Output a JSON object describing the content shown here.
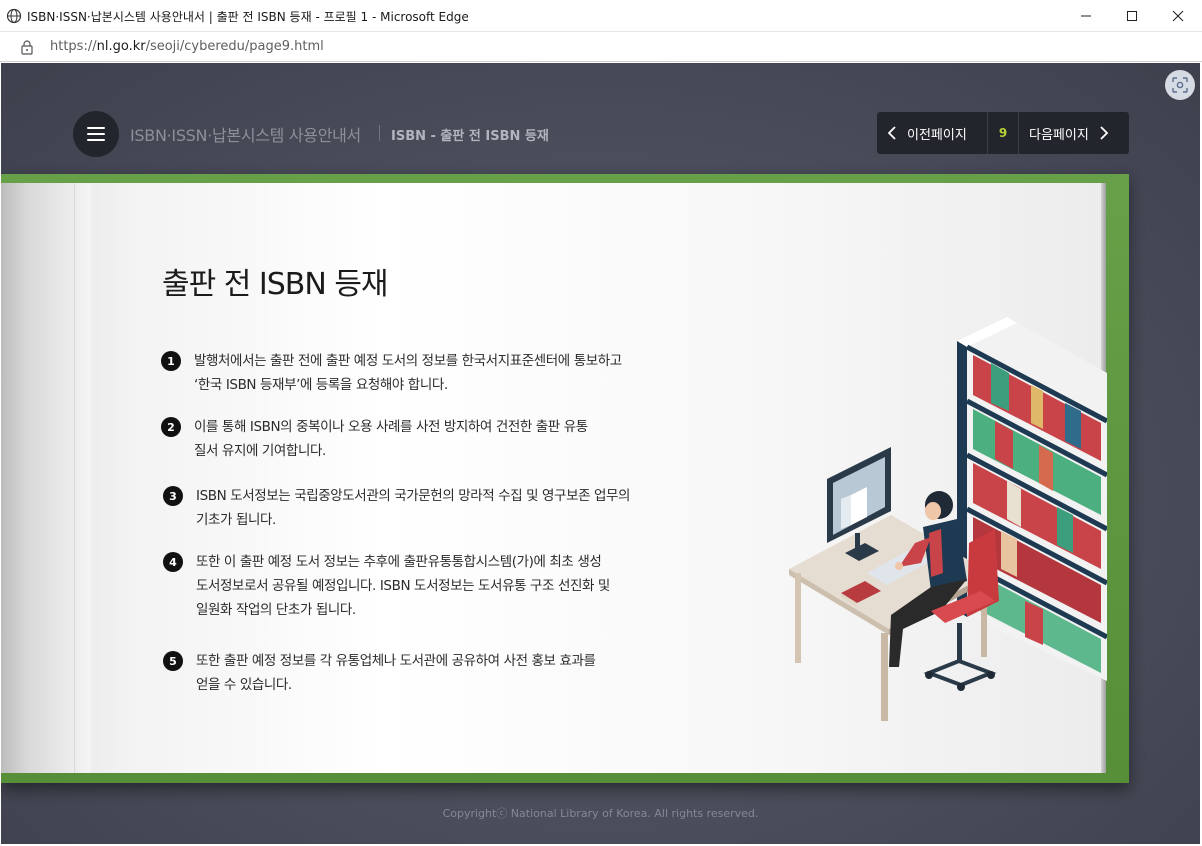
{
  "browser": {
    "title": "ISBN·ISSN·납본시스템 사용안내서 | 출판 전 ISBN 등재 - 프로필 1 - Microsoft Edge",
    "url_prefix": "https://",
    "url_host": "nl.go.kr",
    "url_path": "/seoji/cyberedu/page9.html"
  },
  "header": {
    "site_title": "ISBN·ISSN·납본시스템 사용안내서",
    "page_subtitle": "ISBN - 출판 전 ISBN 등재"
  },
  "pager": {
    "prev_label": "이전페이지",
    "page_number": "9",
    "next_label": "다음페이지",
    "accent_color": "#b9d236"
  },
  "content": {
    "title": "출판 전 ISBN 등재",
    "items": [
      {
        "num": "1",
        "text": "발행처에서는 출판 전에 출판 예정 도서의 정보를 한국서지표준센터에 통보하고\n‘한국 ISBN 등재부’에 등록을 요청해야 합니다."
      },
      {
        "num": "2",
        "text": "이를 통해 ISBN의 중복이나 오용 사례를 사전 방지하여 건전한 출판 유통\n질서 유지에 기여합니다."
      },
      {
        "num": "3",
        "text": "ISBN 도서정보는 국립중앙도서관의 국가문헌의 망라적 수집 및 영구보존 업무의\n기초가 됩니다."
      },
      {
        "num": "4",
        "text": "또한 이 출판 예정 도서 정보는 추후에 출판유통통합시스템(가)에 최초 생성\n도서정보로서 공유될 예정입니다. ISBN 도서정보는 도서유통 구조 선진화 및\n일원화 작업의 단초가 됩니다."
      },
      {
        "num": "5",
        "text": "또한 출판 예정 정보를 각 유통업체나 도서관에 공유하여 사전 홍보 효과를\n얻을 수 있습니다."
      }
    ]
  },
  "footer": {
    "copyright": "Copyrightⓒ National Library of Korea. All rights reserved."
  },
  "icons": {
    "menu": "hamburger-icon",
    "prev": "chevron-left-icon",
    "next": "chevron-right-icon",
    "capture": "screen-capture-icon"
  },
  "colors": {
    "background": "#4b4e5b",
    "book_cover": "#5e9a3d",
    "header_dark": "#23252c"
  }
}
